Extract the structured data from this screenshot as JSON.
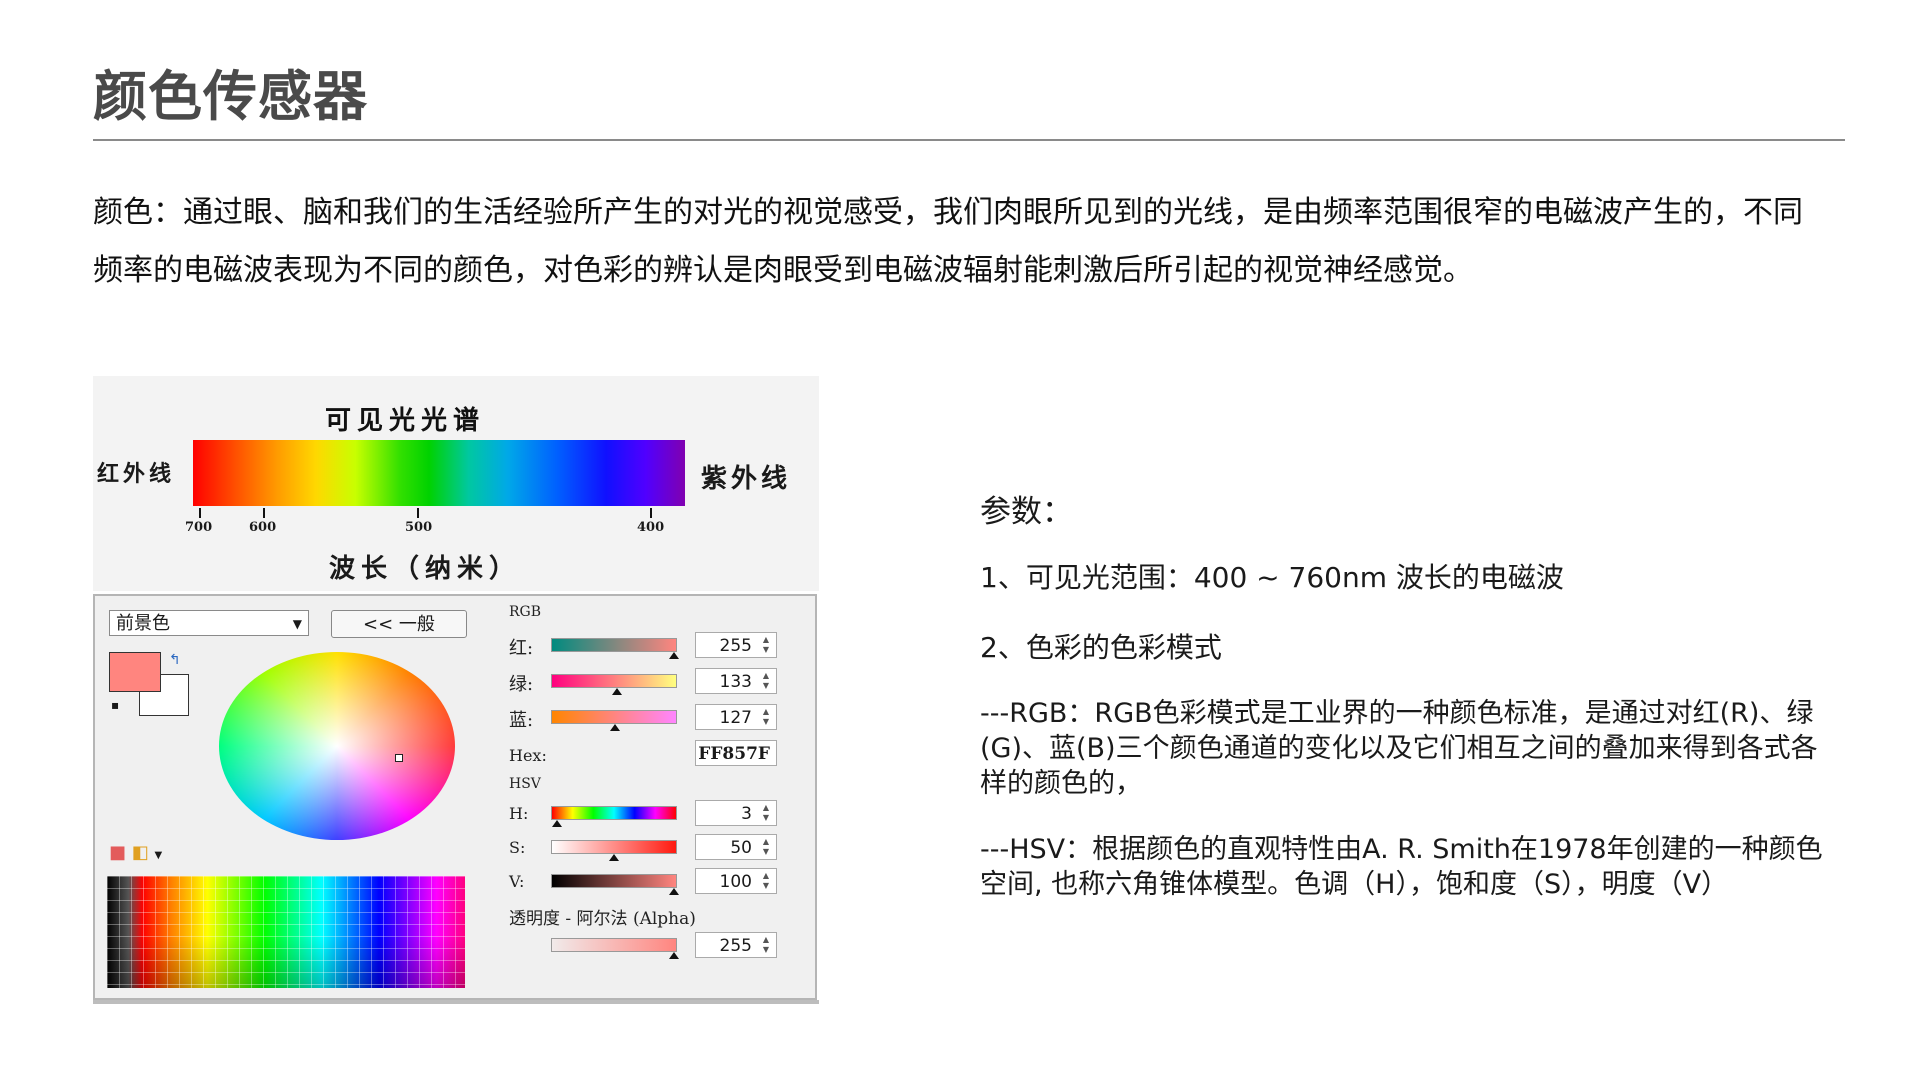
{
  "page": {
    "title": "颜色传感器",
    "intro": "颜色：通过眼、脑和我们的生活经验所产生的对光的视觉感受，我们肉眼所见到的光线，是由频率范围很窄的电磁波产生的，不同频率的电磁波表现为不同的颜色，对色彩的辨认是肉眼受到电磁波辐射能刺激后所引起的视觉神经感觉。"
  },
  "spectrum": {
    "title": "可见光光谱",
    "left_label": "红外线",
    "right_label": "紫外线",
    "axis_label": "波长（纳米）",
    "ticks": [
      "700",
      "600",
      "500",
      "400"
    ]
  },
  "picker": {
    "dropdown_value": "前景色",
    "general_button": "<< 一般",
    "rgb_section": "RGB",
    "red_label": "红:",
    "green_label": "绿:",
    "blue_label": "蓝:",
    "red_value": "255",
    "green_value": "133",
    "blue_value": "127",
    "hex_label": "Hex:",
    "hex_value": "FF857F",
    "hsv_section": "HSV",
    "h_label": "H:",
    "s_label": "S:",
    "v_label": "V:",
    "h_value": "3",
    "s_value": "50",
    "v_value": "100",
    "alpha_label": "透明度 - 阿尔法 (Alpha)",
    "alpha_value": "255",
    "foreground_color": "#ff857f",
    "background_color": "#ffffff"
  },
  "params": {
    "title": "参数：",
    "item1": "1、可见光范围：400 ~ 760nm 波长的电磁波",
    "item2": "2、色彩的色彩模式",
    "rgb_desc": "---RGB：RGB色彩模式是工业界的一种颜色标准，是通过对红(R)、绿(G)、蓝(B)三个颜色通道的变化以及它们相互之间的叠加来得到各式各样的颜色的，",
    "hsv_desc": "---HSV：根据颜色的直观特性由A. R. Smith在1978年创建的一种颜色空间, 也称六角锥体模型。色调（H），饱和度（S），明度（V）"
  }
}
